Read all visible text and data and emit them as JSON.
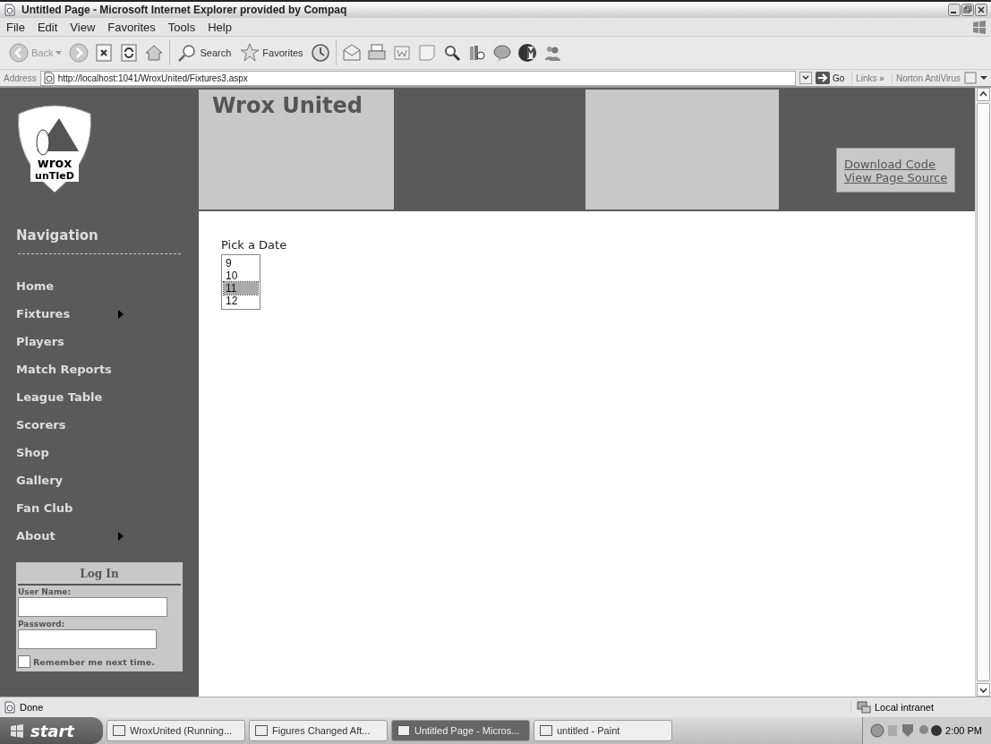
{
  "window": {
    "title": "Untitled Page - Microsoft Internet Explorer provided by Compaq"
  },
  "menu": [
    "File",
    "Edit",
    "View",
    "Favorites",
    "Tools",
    "Help"
  ],
  "toolbar": {
    "back": "Back",
    "search": "Search",
    "favorites": "Favorites"
  },
  "address_bar": {
    "label": "Address",
    "url": "http://localhost:1041/WroxUnited/Fixtures3.aspx",
    "go": "Go",
    "links": "Links",
    "links_more": "»",
    "norton": "Norton AntiVirus"
  },
  "header": {
    "logo_text": [
      "wrox",
      "unTIeD"
    ],
    "title": "Wrox United",
    "links": [
      "Download Code",
      "View Page Source"
    ]
  },
  "navigation": {
    "title": "Navigation",
    "items": [
      {
        "label": "Home",
        "has_submenu": false
      },
      {
        "label": "Fixtures",
        "has_submenu": true
      },
      {
        "label": "Players",
        "has_submenu": false
      },
      {
        "label": "Match Reports",
        "has_submenu": false
      },
      {
        "label": "League Table",
        "has_submenu": false
      },
      {
        "label": "Scorers",
        "has_submenu": false
      },
      {
        "label": "Shop",
        "has_submenu": false
      },
      {
        "label": "Gallery",
        "has_submenu": false
      },
      {
        "label": "Fan Club",
        "has_submenu": false
      },
      {
        "label": "About",
        "has_submenu": true
      }
    ]
  },
  "login": {
    "title": "Log In",
    "user_label": "User Name:",
    "password_label": "Password:",
    "remember": {
      "label": "Remember me next time.",
      "checked": false
    }
  },
  "content": {
    "label": "Pick a Date",
    "options": [
      {
        "label": "9",
        "selected": false
      },
      {
        "label": "10",
        "selected": false
      },
      {
        "label": "11",
        "selected": true
      },
      {
        "label": "12",
        "selected": false
      }
    ]
  },
  "status_bar": {
    "text": "Done",
    "zone": "Local intranet"
  },
  "taskbar": {
    "start": "start",
    "buttons": [
      {
        "label": "WroxUnited (Running...",
        "selected": false
      },
      {
        "label": "Figures Changed Aft...",
        "selected": false
      },
      {
        "label": "Untitled Page - Micros...",
        "selected": true
      },
      {
        "label": "untitled - Paint",
        "selected": false
      }
    ],
    "clock": "2:00 PM"
  }
}
